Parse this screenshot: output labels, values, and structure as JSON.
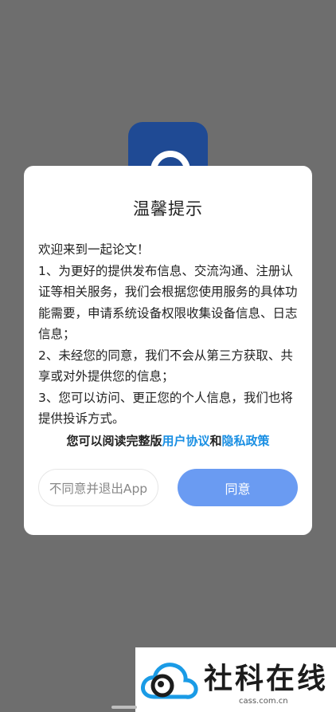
{
  "dialog": {
    "title": "温馨提示",
    "paragraphs": [
      "欢迎来到一起论文！",
      "1、为更好的提供发布信息、交流沟通、注册认证等相关服务，我们会根据您使用服务的具体功能需要，申请系统设备权限收集设备信息、日志信息；",
      "2、未经您的同意，我们不会从第三方获取、共享或对外提供您的信息；",
      "3、您可以访问、更正您的个人信息，我们也将提供投诉方式。"
    ],
    "agree_prefix": "您可以阅读完整版",
    "user_agreement_link": "用户协议",
    "agree_and": "和",
    "privacy_policy_link": "隐私政策",
    "disagree_button": "不同意并退出App",
    "agree_button": "同意"
  },
  "watermark": {
    "text": "社科在线",
    "sub": "cass.com.cn"
  },
  "colors": {
    "overlay": "#6e6e6e",
    "link": "#1a8fe3",
    "agree_button": "#6a9bf2",
    "logo": "#1f4a94"
  }
}
